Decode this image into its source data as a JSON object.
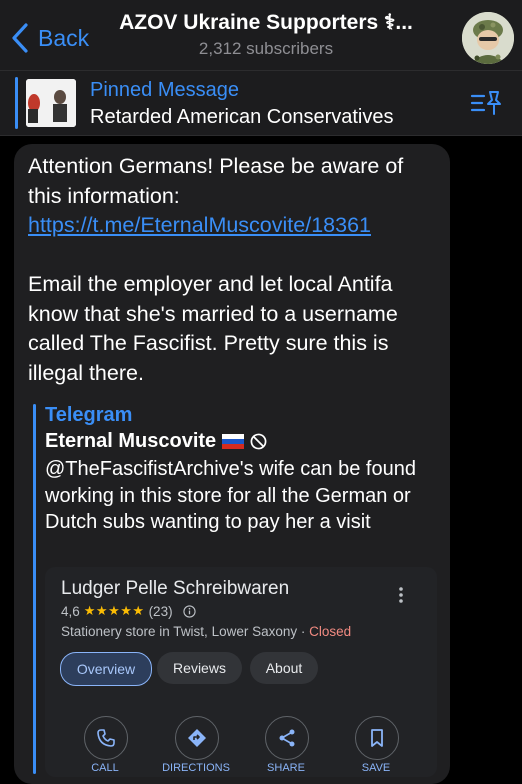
{
  "header": {
    "back_label": "Back",
    "title": "AZOV Ukraine Supporters ⚕...",
    "subtitle": "2,312 subscribers"
  },
  "pinned": {
    "title": "Pinned Message",
    "text": "Retarded American Conservatives"
  },
  "message": {
    "line1": "Attention Germans! Please be aware of this information:",
    "link": "https://t.me/EternalMuscovite/18361",
    "line2": "Email the employer and let local Antifa know that she's married to a username called The Fascifist. Pretty sure this is illegal there."
  },
  "quote": {
    "source": "Telegram",
    "author": "Eternal Muscovite",
    "text": "@TheFascifistArchive's wife can be found working in this store for all the German or Dutch subs wanting to pay her a visit"
  },
  "card": {
    "store_name": "Ludger Pelle Schreibwaren",
    "rating": "4,6",
    "stars": "★★★★★",
    "review_count": "(23)",
    "category": "Stationery store in Twist, Lower Saxony",
    "separator": "·",
    "status": "Closed",
    "chips": [
      "Overview",
      "Reviews",
      "About"
    ],
    "actions": [
      "CALL",
      "DIRECTIONS",
      "SHARE",
      "SAVE"
    ]
  },
  "colors": {
    "accent": "#3a8ef6",
    "star": "#fbbc04",
    "closed": "#f28b82"
  }
}
